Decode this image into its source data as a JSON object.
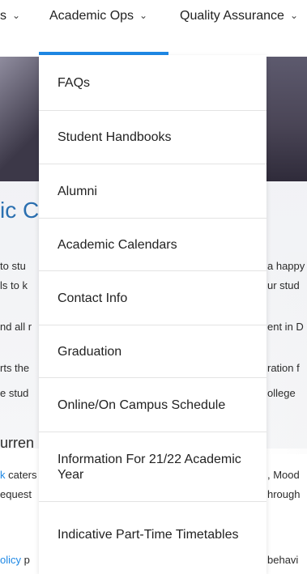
{
  "nav": {
    "items": [
      {
        "label": "s",
        "chevron": true
      },
      {
        "label": "Academic Ops",
        "chevron": true
      },
      {
        "label": "Quality Assurance",
        "chevron": true
      }
    ],
    "active_index": 1
  },
  "dropdown": {
    "items": [
      {
        "label": "FAQs"
      },
      {
        "label": "Student Handbooks"
      },
      {
        "label": "Alumni"
      },
      {
        "label": "Academic Calendars"
      },
      {
        "label": "Contact Info"
      },
      {
        "label": "Graduation"
      },
      {
        "label": "Online/On Campus Schedule"
      },
      {
        "label": "Information For 21/22 Academic Year"
      },
      {
        "label": "Indicative Part-Time Timetables"
      }
    ]
  },
  "background": {
    "heading": "ic Operations",
    "heading_visible": "ic C",
    "paragraphs": [
      {
        "left": "to stu",
        "right": "a happy"
      },
      {
        "left": "ls to k",
        "right": "ur stud"
      },
      {
        "left": "nd all r",
        "right": "ent in D"
      },
      {
        "left": "rts the",
        "right": "ration f"
      },
      {
        "left": "e stud",
        "right": "ollege"
      },
      {
        "left": "k",
        "left_tail": " caters",
        "right": ", Mood"
      },
      {
        "left": "equest",
        "right": "hrough"
      },
      {
        "left": "olicy",
        "left_tail": " p",
        "right": "behavi"
      }
    ],
    "subhead": "urrent Students",
    "subhead_visible": "urren"
  },
  "colors": {
    "accent": "#1e88e5",
    "heading": "#2a6fb0"
  }
}
